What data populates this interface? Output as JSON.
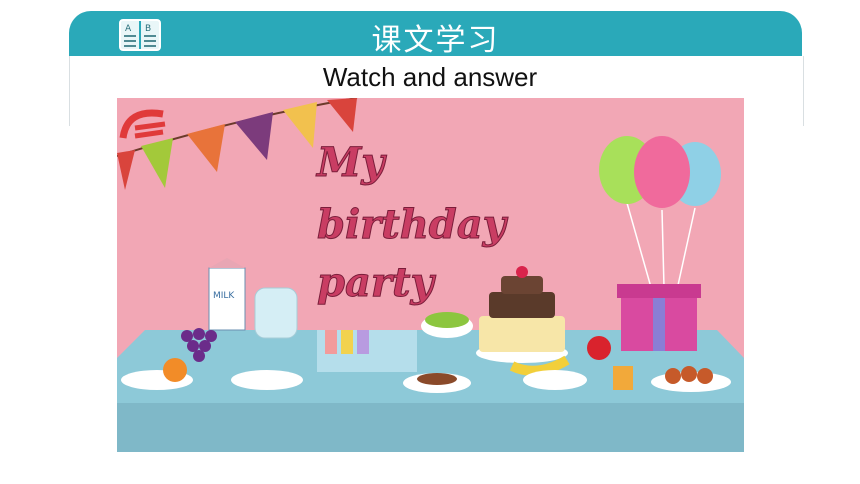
{
  "header": {
    "title": "课文学习",
    "icon": "textbook-icon"
  },
  "subtitle": "Watch and answer",
  "video": {
    "title_lines": [
      "My",
      "birthday",
      "party"
    ],
    "milk_label": "MILK"
  },
  "colors": {
    "header_bg": "#2aa9b9",
    "scene_bg": "#f2a7b5",
    "table": "#8dc9d8"
  }
}
